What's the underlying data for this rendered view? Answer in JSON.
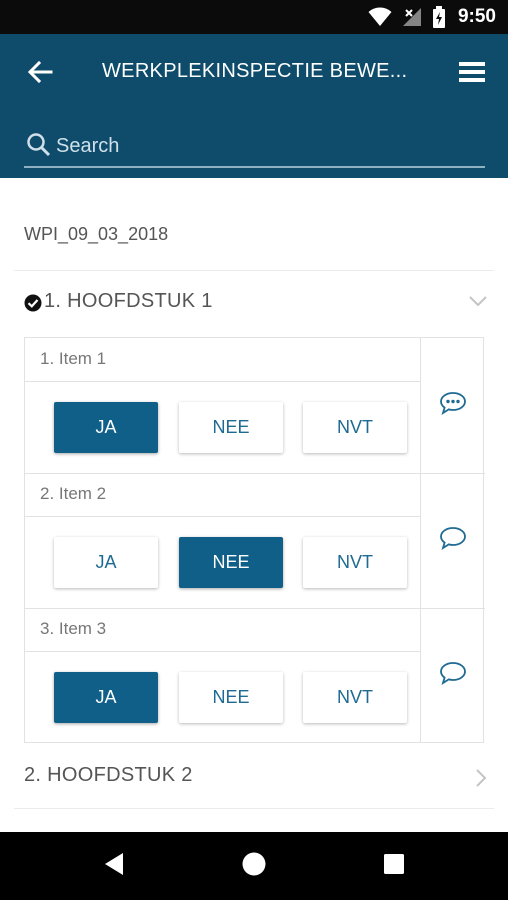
{
  "status_bar": {
    "time": "9:50",
    "icons": [
      "wifi-icon",
      "signal-icon",
      "battery-charging-icon"
    ]
  },
  "header": {
    "title": "WERKPLEKINSPECTIE BEWE...",
    "back_icon": "arrow-back-icon",
    "menu_icon": "hamburger-menu-icon",
    "search": {
      "placeholder": "Search",
      "value": ""
    }
  },
  "inspection": {
    "name": "WPI_09_03_2018"
  },
  "chapters": [
    {
      "title": "1. HOOFDSTUK 1",
      "completed": true,
      "expanded": true,
      "items": [
        {
          "label": "1. Item 1",
          "options": [
            "JA",
            "NEE",
            "NVT"
          ],
          "selected": "JA",
          "comment_icon": "comment-dots-icon"
        },
        {
          "label": "2. Item 2",
          "options": [
            "JA",
            "NEE",
            "NVT"
          ],
          "selected": "NEE",
          "comment_icon": "comment-icon"
        },
        {
          "label": "3. Item 3",
          "options": [
            "JA",
            "NEE",
            "NVT"
          ],
          "selected": "JA",
          "comment_icon": "comment-icon"
        }
      ]
    },
    {
      "title": "2. HOOFDSTUK 2",
      "completed": false,
      "expanded": false
    }
  ],
  "colors": {
    "header_bg": "#0f4c6b",
    "selected_bg": "#0f5f89",
    "accent_text": "#1e6a93"
  },
  "nav": {
    "back_icon": "nav-back-triangle-icon",
    "home_icon": "nav-home-circle-icon",
    "recent_icon": "nav-recent-square-icon"
  }
}
